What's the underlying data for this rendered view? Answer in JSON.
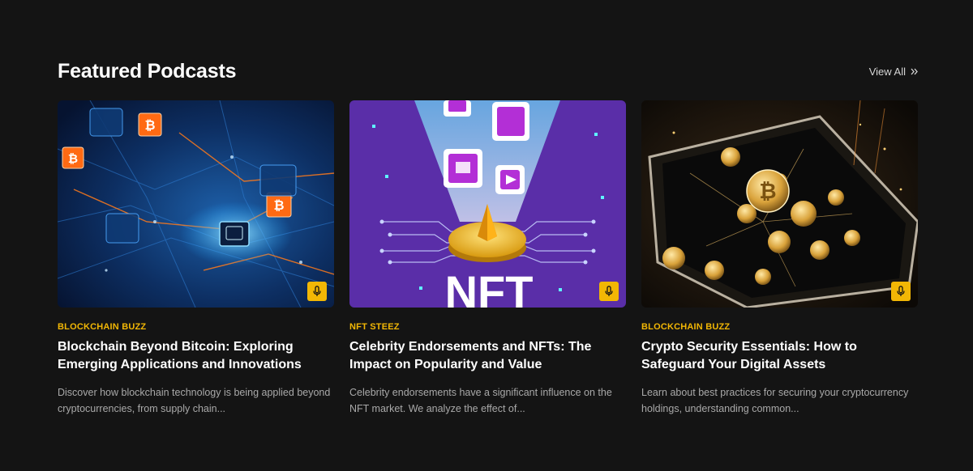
{
  "section": {
    "title": "Featured Podcasts",
    "view_all_label": "View All"
  },
  "cards": [
    {
      "category": "BLOCKCHAIN BUZZ",
      "title": "Blockchain Beyond Bitcoin: Exploring Emerging Applications and Innovations",
      "description": "Discover how blockchain technology is being applied beyond cryptocurrencies, from supply chain...",
      "image_icon": "blockchain-network-illustration",
      "badge_icon": "microphone-icon"
    },
    {
      "category": "NFT STEEZ",
      "title": "Celebrity Endorsements and NFTs: The Impact on Popularity and Value",
      "description": "Celebrity endorsements have a significant influence on the NFT market. We analyze the effect of...",
      "image_icon": "nft-coin-illustration",
      "image_text": "NFT",
      "badge_icon": "microphone-icon"
    },
    {
      "category": "BLOCKCHAIN BUZZ",
      "title": "Crypto Security Essentials: How to Safeguard Your Digital Assets",
      "description": "Learn about best practices for securing your cryptocurrency holdings, understanding common...",
      "image_icon": "smartphone-coins-illustration",
      "badge_icon": "microphone-icon"
    }
  ],
  "colors": {
    "background": "#141414",
    "accent": "#f2b705",
    "nft_purple": "#5b2fa8"
  }
}
